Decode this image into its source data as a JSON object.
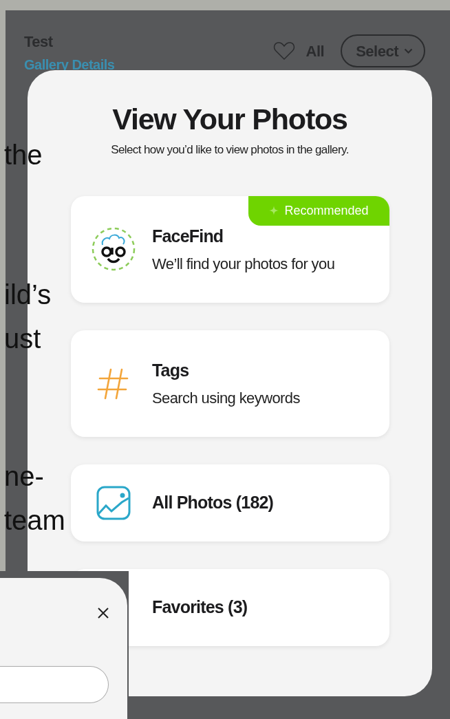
{
  "page": {
    "title": "Test",
    "link": "Gallery Details",
    "filter": "All",
    "select_button": "Select"
  },
  "background_text": [
    "the",
    "ild’s",
    "ust",
    "ne-",
    "team"
  ],
  "modal": {
    "title": "View Your Photos",
    "subtitle": "Select how you’d like to view photos in the gallery.",
    "options": [
      {
        "kind": "facefind",
        "title": "FaceFind",
        "description": "We’ll find your photos for you",
        "badge": "Recommended"
      },
      {
        "kind": "tags",
        "title": "Tags",
        "description": "Search using keywords"
      },
      {
        "kind": "photos",
        "title": "All Photos (182)"
      },
      {
        "kind": "favorites",
        "title": "Favorites (3)"
      }
    ]
  }
}
